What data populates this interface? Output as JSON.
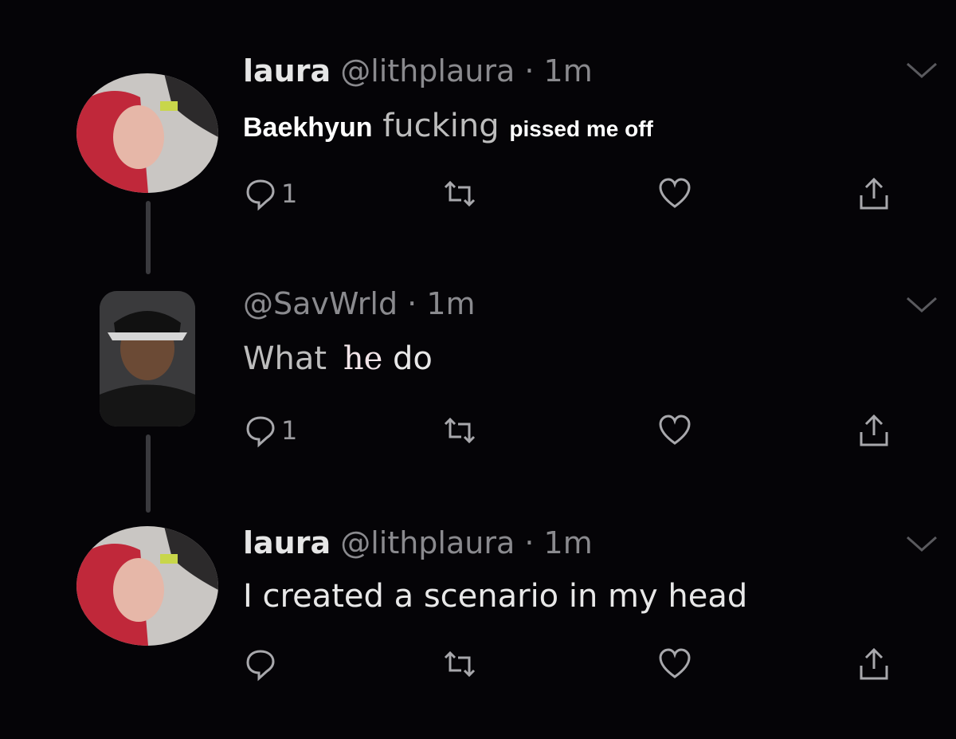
{
  "tweets": [
    {
      "name": "laura",
      "handle": "@lithplaura",
      "separator": "·",
      "time": "1m",
      "text_parts": [
        "Baekhyun",
        "fucking",
        "pissed me off"
      ],
      "reply_count": "1"
    },
    {
      "name": "",
      "handle": "@SavWrld",
      "separator": "·",
      "time": "1m",
      "text_parts": [
        "What",
        "he",
        "do"
      ],
      "reply_count": "1"
    },
    {
      "name": "laura",
      "handle": "@lithplaura",
      "separator": "·",
      "time": "1m",
      "text": "I created a scenario in my head",
      "reply_count": ""
    }
  ],
  "icons": {
    "reply": "reply-icon",
    "retweet": "retweet-icon",
    "like": "heart-icon",
    "share": "share-icon",
    "menu": "chevron-down-icon"
  },
  "colors": {
    "background": "#050407",
    "muted": "#8a8a8e",
    "text": "#e8e8e8"
  }
}
